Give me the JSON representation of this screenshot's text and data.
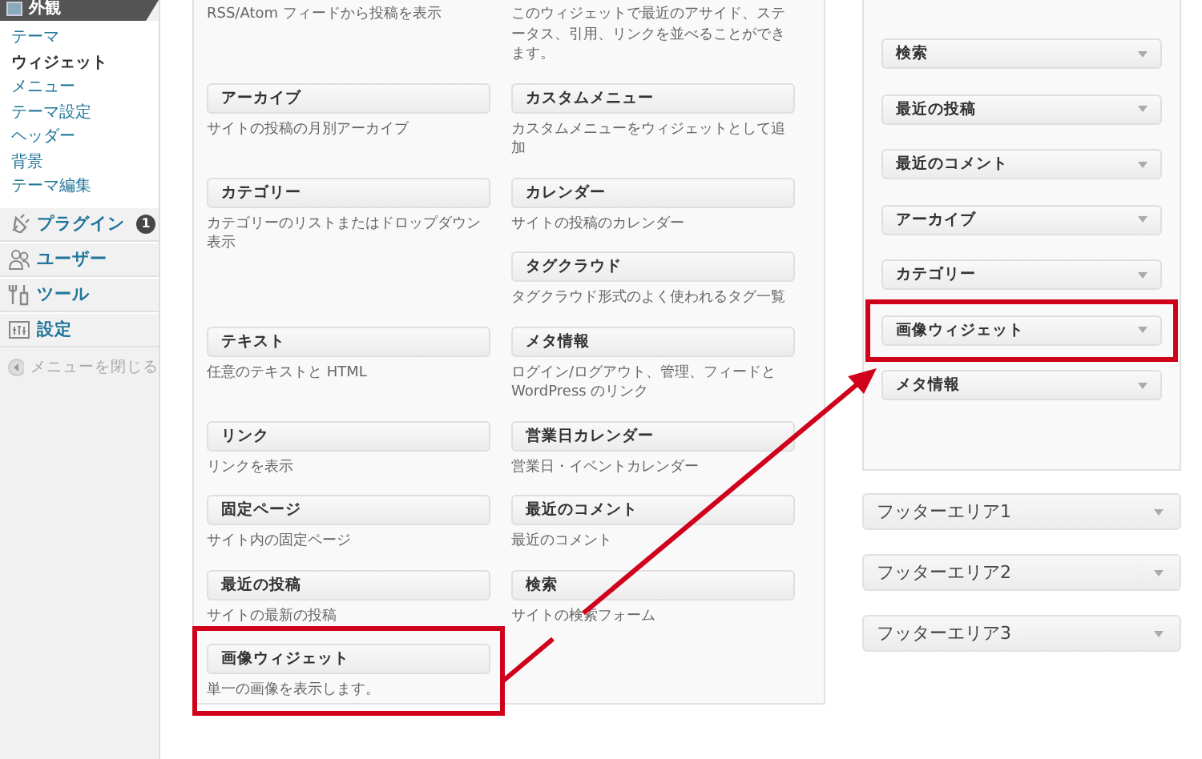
{
  "admin_menu": {
    "current": {
      "label": "外観"
    },
    "submenu": [
      {
        "label": "テーマ",
        "selected": false
      },
      {
        "label": "ウィジェット",
        "selected": true
      },
      {
        "label": "メニュー",
        "selected": false
      },
      {
        "label": "テーマ設定",
        "selected": false
      },
      {
        "label": "ヘッダー",
        "selected": false
      },
      {
        "label": "背景",
        "selected": false
      },
      {
        "label": "テーマ編集",
        "selected": false
      }
    ],
    "items": [
      {
        "label": "プラグイン",
        "kind": "plugins",
        "badge": "1"
      },
      {
        "label": "ユーザー",
        "kind": "users"
      },
      {
        "label": "ツール",
        "kind": "tools"
      },
      {
        "label": "設定",
        "kind": "settings"
      }
    ],
    "collapse": {
      "label": "メニューを閉じる"
    }
  },
  "available_widgets": {
    "rows": [
      [
        [
          {
            "description": "RSS/Atom フィードから投稿を表示",
            "highlighted": false
          }
        ],
        [
          {
            "description": "このウィジェットで最近のアサイド、ステータス、引用、リンクを並べることができます。",
            "highlighted": false
          }
        ]
      ],
      [
        [
          {
            "title": "アーカイブ",
            "description": "サイトの投稿の月別アーカイブ",
            "highlighted": false
          }
        ],
        [
          {
            "title": "カスタムメニュー",
            "description": "カスタムメニューをウィジェットとして追加",
            "highlighted": false
          }
        ]
      ],
      [
        [
          {
            "title": "カテゴリー",
            "description": "カテゴリーのリストまたはドロップダウン表示",
            "highlighted": false
          }
        ],
        [
          {
            "title": "カレンダー",
            "description": "サイトの投稿のカレンダー",
            "highlighted": false
          },
          {
            "title": "タグクラウド",
            "description": "タグクラウド形式のよく使われるタグ一覧",
            "highlighted": false
          }
        ]
      ],
      [
        [
          {
            "title": "テキスト",
            "description": "任意のテキストと HTML",
            "highlighted": false
          }
        ],
        [
          {
            "title": "メタ情報",
            "description": "ログイン/ログアウト、管理、フィードと WordPress のリンク",
            "highlighted": false
          }
        ]
      ],
      [
        [
          {
            "title": "リンク",
            "description": "リンクを表示",
            "highlighted": false
          }
        ],
        [
          {
            "title": "営業日カレンダー",
            "description": "営業日・イベントカレンダー",
            "highlighted": false
          }
        ]
      ],
      [
        [
          {
            "title": "固定ページ",
            "description": "サイト内の固定ページ",
            "highlighted": false
          }
        ],
        [
          {
            "title": "最近のコメント",
            "description": "最近のコメント",
            "highlighted": false
          }
        ]
      ],
      [
        [
          {
            "title": "最近の投稿",
            "description": "サイトの最新の投稿",
            "highlighted": false
          }
        ],
        [
          {
            "title": "検索",
            "description": "サイトの検索フォーム",
            "highlighted": false
          }
        ]
      ],
      [
        [
          {
            "title": "画像ウィジェット",
            "description": "単一の画像を表示します。",
            "highlighted": true
          }
        ],
        []
      ]
    ]
  },
  "sidebar_area": {
    "widgets": [
      {
        "title": "検索",
        "highlighted": false
      },
      {
        "title": "最近の投稿",
        "highlighted": false
      },
      {
        "title": "最近のコメント",
        "highlighted": false
      },
      {
        "title": "アーカイブ",
        "highlighted": false
      },
      {
        "title": "カテゴリー",
        "highlighted": false
      },
      {
        "title": "画像ウィジェット",
        "highlighted": true
      },
      {
        "title": "メタ情報",
        "highlighted": false
      }
    ]
  },
  "footer_areas": [
    {
      "title": "フッターエリア1"
    },
    {
      "title": "フッターエリア2"
    },
    {
      "title": "フッターエリア3"
    }
  ]
}
